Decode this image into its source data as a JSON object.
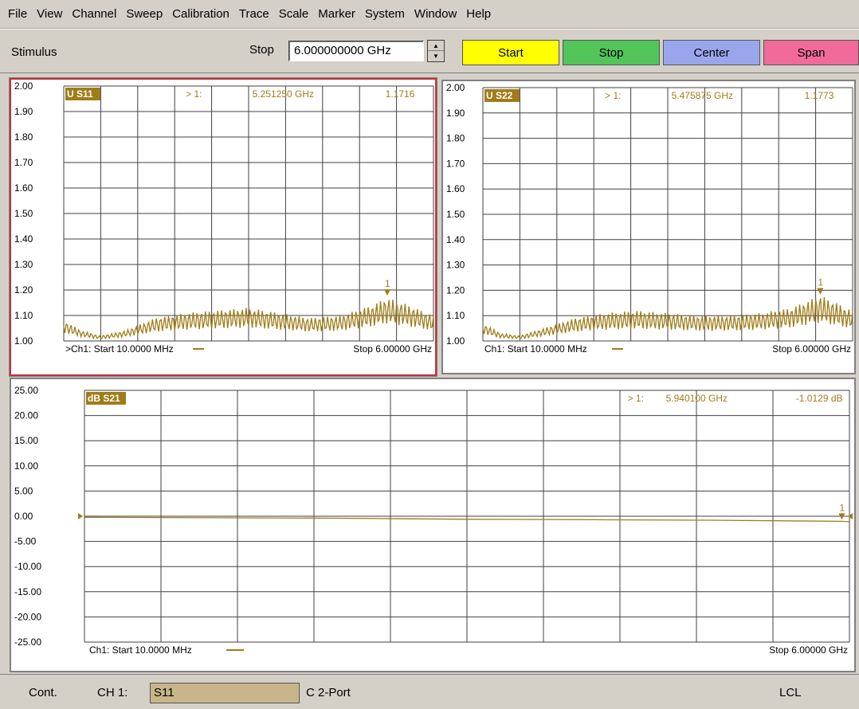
{
  "menu": [
    "File",
    "View",
    "Channel",
    "Sweep",
    "Calibration",
    "Trace",
    "Scale",
    "Marker",
    "System",
    "Window",
    "Help"
  ],
  "stimulus": {
    "label": "Stimulus",
    "field_label": "Stop",
    "value": "6.000000000 GHz",
    "buttons": [
      {
        "label": "Start",
        "color": "#ffff00"
      },
      {
        "label": "Stop",
        "color": "#52c45a"
      },
      {
        "label": "Center",
        "color": "#9aa6ec"
      },
      {
        "label": "Span",
        "color": "#f06a9a"
      }
    ]
  },
  "colors": {
    "trace": "#a07c18",
    "grid": "#404040",
    "active_border": "#c8303a",
    "badge": "#a07c18"
  },
  "plots": [
    {
      "id": "s11",
      "trace_label": "U S11",
      "marker_text": "> 1:",
      "marker_freq": "5.251250 GHz",
      "marker_value": "1.1716",
      "marker_num": "1",
      "y_ticks": [
        "2.00",
        "1.90",
        "1.80",
        "1.70",
        "1.60",
        "1.50",
        "1.40",
        "1.30",
        "1.20",
        "1.10",
        "1.00"
      ],
      "footer_left": ">Ch1: Start  10.0000 MHz",
      "footer_right": "Stop  6.00000 GHz",
      "active": true
    },
    {
      "id": "s22",
      "trace_label": "U S22",
      "marker_text": "> 1:",
      "marker_freq": "5.475875 GHz",
      "marker_value": "1.1773",
      "marker_num": "1",
      "y_ticks": [
        "2.00",
        "1.90",
        "1.80",
        "1.70",
        "1.60",
        "1.50",
        "1.40",
        "1.30",
        "1.20",
        "1.10",
        "1.00"
      ],
      "footer_left": "Ch1: Start  10.0000 MHz",
      "footer_right": "Stop  6.00000 GHz",
      "active": false
    },
    {
      "id": "s21",
      "trace_label": "dB S21",
      "marker_text": "> 1:",
      "marker_freq": "5.940100 GHz",
      "marker_value": "-1.0129 dB",
      "marker_num": "1",
      "y_ticks": [
        "25.00",
        "20.00",
        "15.00",
        "10.00",
        "5.00",
        "0.00",
        "-5.00",
        "-10.00",
        "-15.00",
        "-20.00",
        "-25.00"
      ],
      "footer_left": "Ch1: Start  10.0000 MHz",
      "footer_right": "Stop  6.00000 GHz",
      "active": false
    }
  ],
  "chart_data": [
    {
      "type": "line",
      "title": "U S11",
      "xlim": [
        0.01,
        6.0
      ],
      "ylim": [
        1.0,
        2.0
      ],
      "series": [
        {
          "name": "U S11",
          "x": [
            0.01,
            0.3,
            0.6,
            1.0,
            1.5,
            2.0,
            2.5,
            3.0,
            3.5,
            4.0,
            4.5,
            5.0,
            5.25,
            5.5,
            6.0
          ],
          "y": [
            1.08,
            1.04,
            1.02,
            1.04,
            1.09,
            1.11,
            1.12,
            1.13,
            1.11,
            1.09,
            1.1,
            1.14,
            1.17,
            1.15,
            1.1
          ]
        }
      ],
      "marker": {
        "x": 5.25125,
        "y": 1.1716
      }
    },
    {
      "type": "line",
      "title": "U S22",
      "xlim": [
        0.01,
        6.0
      ],
      "ylim": [
        1.0,
        2.0
      ],
      "series": [
        {
          "name": "U S22",
          "x": [
            0.01,
            0.3,
            0.6,
            1.0,
            1.5,
            2.0,
            2.5,
            3.0,
            3.5,
            4.0,
            4.5,
            5.0,
            5.48,
            6.0
          ],
          "y": [
            1.07,
            1.03,
            1.02,
            1.05,
            1.09,
            1.11,
            1.12,
            1.11,
            1.1,
            1.1,
            1.11,
            1.13,
            1.18,
            1.12
          ]
        }
      ],
      "marker": {
        "x": 5.475875,
        "y": 1.1773
      }
    },
    {
      "type": "line",
      "title": "dB S21",
      "xlim": [
        0.01,
        6.0
      ],
      "ylim": [
        -25.0,
        25.0
      ],
      "series": [
        {
          "name": "dB S21",
          "x": [
            0.01,
            1.0,
            2.0,
            3.0,
            4.0,
            5.0,
            5.94,
            6.0
          ],
          "y": [
            -0.2,
            -0.3,
            -0.4,
            -0.6,
            -0.7,
            -0.8,
            -1.0129,
            -1.1
          ]
        }
      ],
      "marker": {
        "x": 5.9401,
        "y": -1.0129
      }
    }
  ],
  "status": {
    "mode": "Cont.",
    "channel": "CH 1:",
    "param": "S11",
    "cal": "C  2-Port",
    "remote": "LCL"
  }
}
